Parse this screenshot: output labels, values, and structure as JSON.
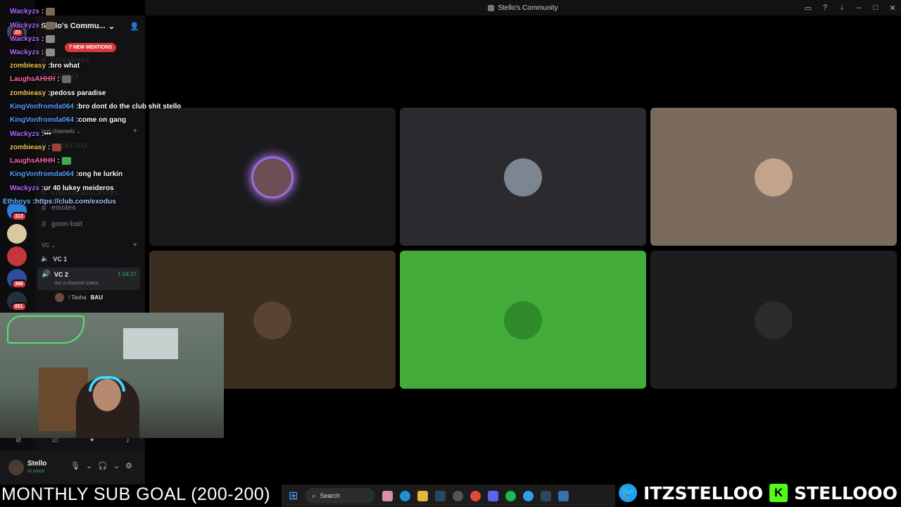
{
  "window": {
    "title": "Stello's Community"
  },
  "server": {
    "name": "Stello's Commu...",
    "mentions": "7 NEW MENTIONS"
  },
  "rail_badges": [
    "23",
    "313",
    "368",
    "651"
  ],
  "channels": [
    {
      "label": "GIVEAWAYS",
      "dim": true
    },
    {
      "label": "SOCIALS",
      "dim": true
    },
    {
      "label": "MAIN-CHAT",
      "dim": true
    },
    {
      "label": "STREAM-SUGGESTIO...",
      "dim": true
    },
    {
      "label": "emotes",
      "dim": false
    },
    {
      "label": "goon-bait",
      "dim": false
    }
  ],
  "categories": {
    "text": "text channels",
    "voice": "VC"
  },
  "voice": {
    "vc1": "VC 1",
    "vc2": "VC 2",
    "vc2_time": "1:04:27",
    "vc2_status": "Set a channel status",
    "member": "! Tasha",
    "member_tag": "BAU"
  },
  "user": {
    "name": "Stello",
    "status": "In voice"
  },
  "chat": [
    {
      "user": "Wackyzs",
      "color": "purple",
      "text": "",
      "emote": "#7a6a5a"
    },
    {
      "user": "Wackyzs",
      "color": "purple",
      "text": "",
      "emote": "#7a6a5a"
    },
    {
      "user": "Wackyzs",
      "color": "purple",
      "text": "",
      "emote": "#8a8a8a"
    },
    {
      "user": "Wackyzs",
      "color": "purple",
      "text": "",
      "emote": "#8a8a8a"
    },
    {
      "user": "zombieasy",
      "color": "yellow",
      "text": "bro what",
      "emote": ""
    },
    {
      "user": "LaughsAHHH",
      "color": "pink",
      "text": "",
      "emote": "#6a6a6a"
    },
    {
      "user": "zombieasy",
      "color": "yellow",
      "text": "pedoss paradise",
      "emote": ""
    },
    {
      "user": "KingVonfromda064",
      "color": "blue",
      "text": "bro dont do the club shit stello",
      "emote": ""
    },
    {
      "user": "KingVonfromda064",
      "color": "blue",
      "text": "come on gang",
      "emote": ""
    },
    {
      "user": "Wackyzs",
      "color": "purple",
      "text": "•••",
      "emote": ""
    },
    {
      "user": "zombieasy",
      "color": "yellow",
      "text": "",
      "emote": "#a0403a"
    },
    {
      "user": "LaughsAHHH",
      "color": "pink",
      "text": "",
      "emote": "#3fae4c"
    },
    {
      "user": "KingVonfromda064",
      "color": "blue",
      "text": "ong he lurkin",
      "emote": ""
    },
    {
      "user": "Wackyzs",
      "color": "purple",
      "text": "ur 40 lukey meideros",
      "emote": ""
    },
    {
      "user": "Ethboys",
      "color": "lblue",
      "text": "https://club.com/exodus",
      "emote": "",
      "text_color": "#9ec8ff"
    }
  ],
  "tiles": [
    {
      "bg": "#1a1a1c",
      "avatar": "#6b4f55",
      "speaking": true
    },
    {
      "bg": "#2b2b2f",
      "avatar": "#7d8590",
      "speaking": false
    },
    {
      "bg": "#7b6a5e",
      "avatar": "#c2a48a",
      "speaking": false
    },
    {
      "bg": "#3b2d1f",
      "avatar": "#5a4330",
      "speaking": false
    },
    {
      "bg": "#43ab3a",
      "avatar": "#2e8a2a",
      "speaking": false
    },
    {
      "bg": "#1d1d20",
      "avatar": "#2b2b2b",
      "speaking": false
    }
  ],
  "subgoal": "MONTHLY SUB GOAL (200-200)",
  "taskbar": {
    "search": "Search"
  },
  "socials": {
    "twitter": "ITZSTELLOO",
    "kick": "STELLOOO",
    "kick_icon": "K"
  }
}
